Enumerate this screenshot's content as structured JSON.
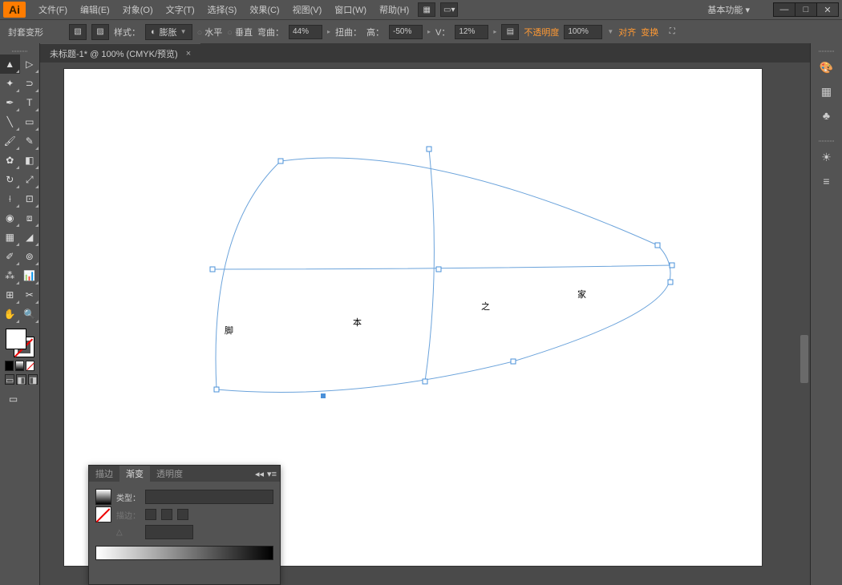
{
  "app": {
    "logo": "Ai"
  },
  "menu": {
    "file": "文件(F)",
    "edit": "编辑(E)",
    "object": "对象(O)",
    "type": "文字(T)",
    "select": "选择(S)",
    "effect": "效果(C)",
    "view": "视图(V)",
    "window": "窗口(W)",
    "help": "帮助(H)"
  },
  "workspace": {
    "label": "基本功能"
  },
  "controlbar": {
    "mode": "封套变形",
    "style_label": "样式：",
    "warp_name": "膨胀",
    "horizontal": "水平",
    "vertical": "垂直",
    "bend_label": "弯曲：",
    "bend_value": "44%",
    "distort_label": "扭曲：",
    "distort_h_label": "高：",
    "distort_h_value": "-50%",
    "distort_v_label": "V：",
    "distort_v_value": "12%",
    "opacity_label": "不透明度",
    "opacity_value": "100%",
    "align": "对齐",
    "transform": "变换"
  },
  "document": {
    "tab_title": "未标题-1* @ 100% (CMYK/预览)",
    "text_content": "脚本之家"
  },
  "gradient_panel": {
    "tab_stroke": "描边",
    "tab_gradient": "渐变",
    "tab_transparency": "透明度",
    "type_label": "类型：",
    "stroke_label": "描边："
  }
}
